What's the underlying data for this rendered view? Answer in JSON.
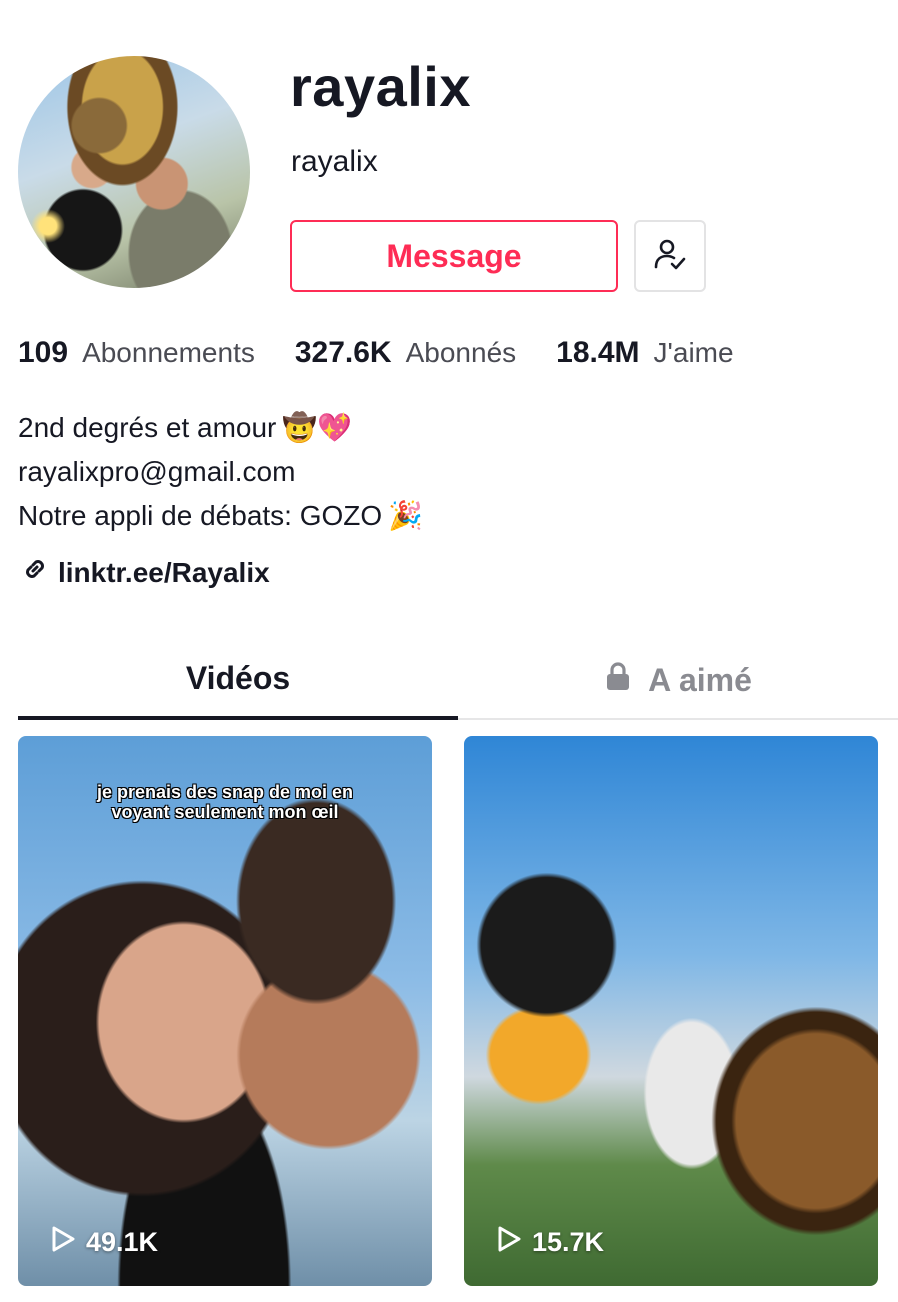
{
  "profile": {
    "display_name": "rayalix",
    "username": "rayalix",
    "avatar_icon": "profile-photo"
  },
  "actions": {
    "message_label": "Message",
    "following_icon": "user-check-icon",
    "accent_color": "#fe2c55"
  },
  "stats": [
    {
      "value": "109",
      "label": "Abonnements"
    },
    {
      "value": "327.6K",
      "label": "Abonnés"
    },
    {
      "value": "18.4M",
      "label": "J'aime"
    }
  ],
  "bio": {
    "line1": "2nd degrés et amour",
    "line1_emojis": "🤠💖",
    "line2": "rayalixpro@gmail.com",
    "line3": "Notre appli de débats: GOZO",
    "line3_emoji": "🎉"
  },
  "link": {
    "icon": "link-icon",
    "text": "linktr.ee/Rayalix"
  },
  "tabs": [
    {
      "label": "Vidéos",
      "active": true
    },
    {
      "label": "A aimé",
      "locked": true
    }
  ],
  "videos": [
    {
      "caption": "je prenais des snap de moi en voyant seulement mon œil",
      "views": "49.1K"
    },
    {
      "caption": "",
      "views": "15.7K"
    }
  ]
}
